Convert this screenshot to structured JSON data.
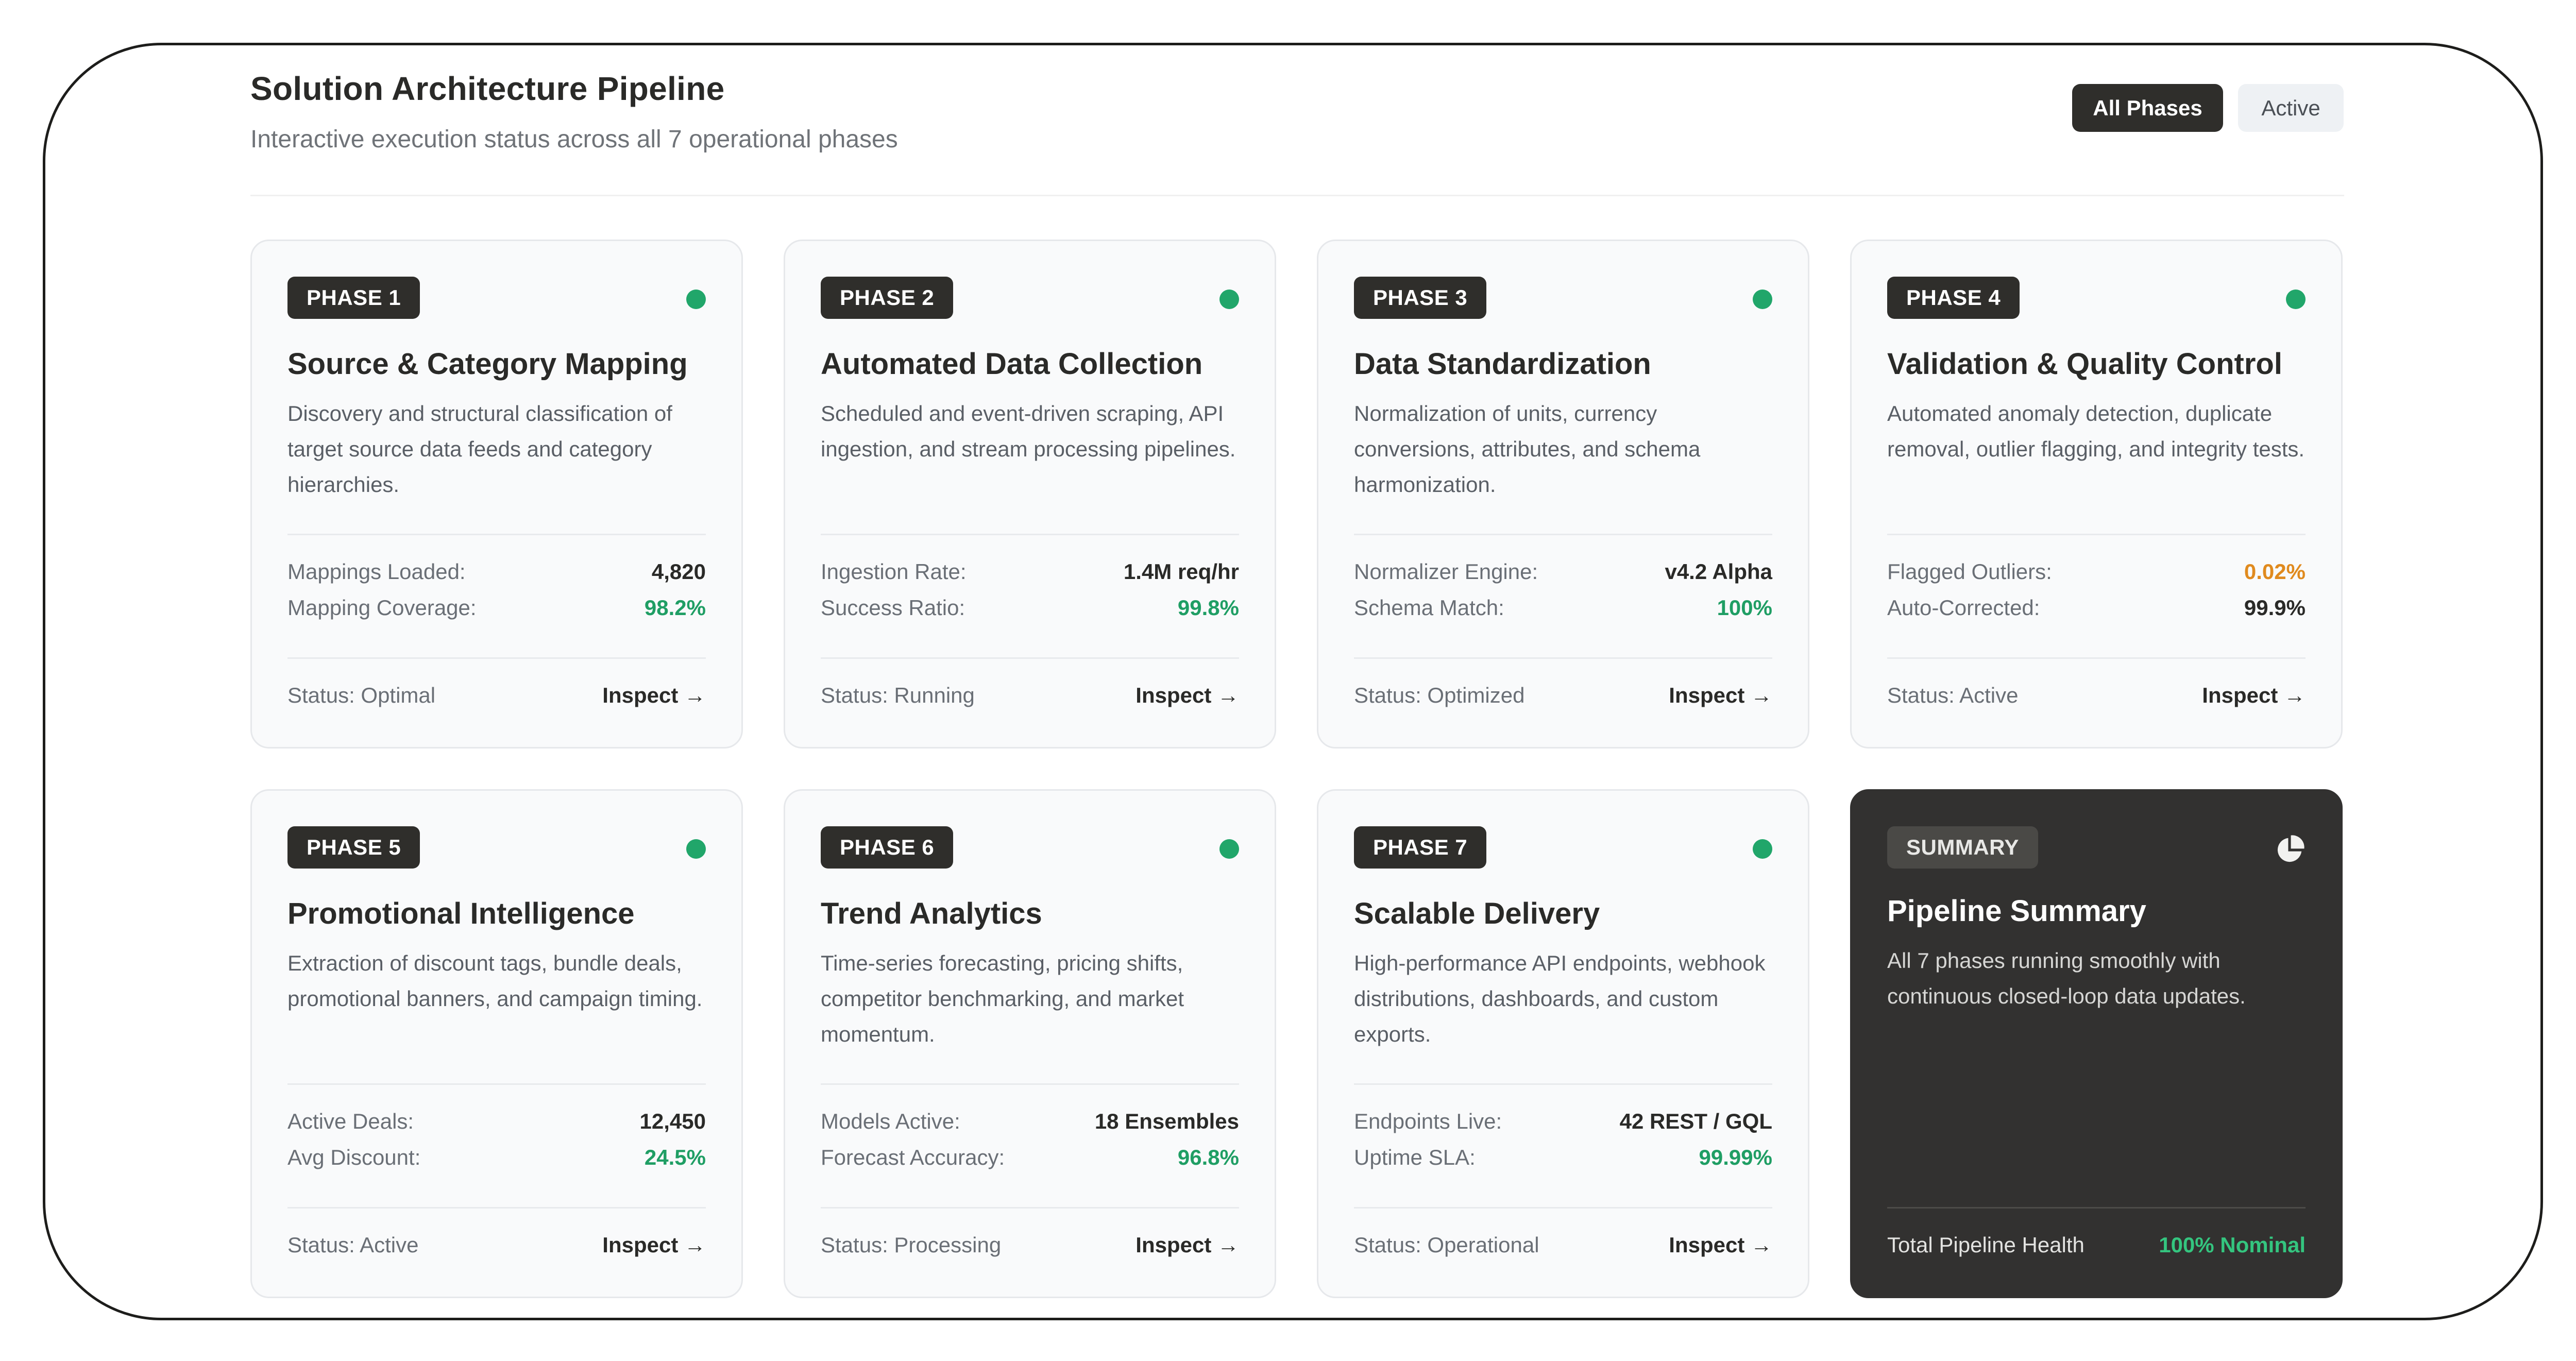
{
  "header": {
    "title": "Solution Architecture Pipeline",
    "subtitle": "Interactive execution status across all 7 operational phases"
  },
  "filters": {
    "all": "All Phases",
    "active": "Active"
  },
  "colors": {
    "status_dot": "#21a66a",
    "positive": "#1f9e64",
    "warning": "#e08a1e",
    "dark_card": "#323130"
  },
  "phases": [
    {
      "badge": "PHASE 1",
      "title": "Source & Category Mapping",
      "description": "Discovery and structural classification of target source data feeds and category hierarchies.",
      "metrics": [
        {
          "label": "Mappings Loaded:",
          "value": "4,820"
        },
        {
          "label": "Mapping Coverage:",
          "value": "98.2%"
        }
      ],
      "status": "Status: Optimal",
      "action": "Inspect →"
    },
    {
      "badge": "PHASE 2",
      "title": "Automated Data Collection",
      "description": "Scheduled and event-driven scraping, API ingestion, and stream processing pipelines.",
      "metrics": [
        {
          "label": "Ingestion Rate:",
          "value": "1.4M req/hr"
        },
        {
          "label": "Success Ratio:",
          "value": "99.8%"
        }
      ],
      "status": "Status: Running",
      "action": "Inspect →"
    },
    {
      "badge": "PHASE 3",
      "title": "Data Standardization",
      "description": "Normalization of units, currency conversions, attributes, and schema harmonization.",
      "metrics": [
        {
          "label": "Normalizer Engine:",
          "value": "v4.2 Alpha"
        },
        {
          "label": "Schema Match:",
          "value": "100%"
        }
      ],
      "status": "Status: Optimized",
      "action": "Inspect →"
    },
    {
      "badge": "PHASE 4",
      "title": "Validation & Quality Control",
      "description": "Automated anomaly detection, duplicate removal, outlier flagging, and integrity tests.",
      "metrics": [
        {
          "label": "Flagged Outliers:",
          "value": "0.02%"
        },
        {
          "label": "Auto-Corrected:",
          "value": "99.9%"
        }
      ],
      "status": "Status: Active",
      "action": "Inspect →"
    },
    {
      "badge": "PHASE 5",
      "title": "Promotional Intelligence",
      "description": "Extraction of discount tags, bundle deals, promotional banners, and campaign timing.",
      "metrics": [
        {
          "label": "Active Deals:",
          "value": "12,450"
        },
        {
          "label": "Avg Discount:",
          "value": "24.5%"
        }
      ],
      "status": "Status: Active",
      "action": "Inspect →"
    },
    {
      "badge": "PHASE 6",
      "title": "Trend Analytics",
      "description": "Time-series forecasting, pricing shifts, competitor benchmarking, and market momentum.",
      "metrics": [
        {
          "label": "Models Active:",
          "value": "18 Ensembles"
        },
        {
          "label": "Forecast Accuracy:",
          "value": "96.8%"
        }
      ],
      "status": "Status: Processing",
      "action": "Inspect →"
    },
    {
      "badge": "PHASE 7",
      "title": "Scalable Delivery",
      "description": "High-performance API endpoints, webhook distributions, dashboards, and custom exports.",
      "metrics": [
        {
          "label": "Endpoints Live:",
          "value": "42 REST / GQL"
        },
        {
          "label": "Uptime SLA:",
          "value": "99.99%"
        }
      ],
      "status": "Status: Operational",
      "action": "Inspect →"
    }
  ],
  "summary": {
    "badge": "SUMMARY",
    "icon": "pie-chart-icon",
    "title": "Pipeline Summary",
    "description": "All 7 phases running smoothly with continuous closed-loop data updates.",
    "footer_label": "Total Pipeline Health",
    "footer_value": "100% Nominal"
  }
}
